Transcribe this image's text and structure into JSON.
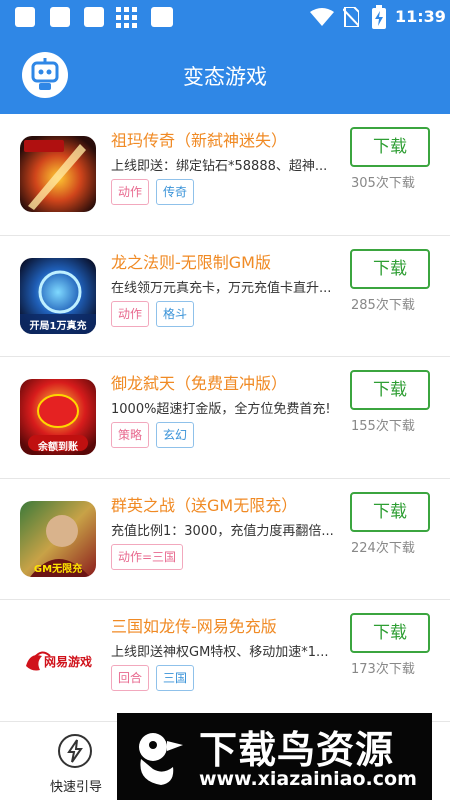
{
  "status_bar": {
    "time": "11:39",
    "icons": [
      "app-square-icon",
      "app-square-icon",
      "app-square-icon",
      "grid-icon",
      "app-square-icon",
      "wifi-icon",
      "no-sim-icon",
      "battery-charging-icon"
    ]
  },
  "header": {
    "title": "变态游戏",
    "avatar_icon": "robot-avatar-icon"
  },
  "games": [
    {
      "name": "祖玛传奇（新弑神迷失）",
      "desc": "上线即送：绑定钻石*58888、超神...",
      "tags": [
        "动作",
        "传奇"
      ],
      "download_label": "下载",
      "downloads": "305次下载",
      "icon_caption": ""
    },
    {
      "name": "龙之法则-无限制GM版",
      "desc": "在线领万元真充卡，万元充值卡直升...",
      "tags": [
        "动作",
        "格斗"
      ],
      "download_label": "下载",
      "downloads": "285次下载",
      "icon_caption": "开局1万真充"
    },
    {
      "name": "御龙弑天（免费直冲版）",
      "desc": "1000%超速打金版，全方位免费首充!",
      "tags": [
        "策略",
        "玄幻"
      ],
      "download_label": "下载",
      "downloads": "155次下载",
      "icon_caption": "余额到账"
    },
    {
      "name": "群英之战（送GM无限充）",
      "desc": "充值比例1：3000，充值力度再翻倍...",
      "tags": [
        "动作=三国"
      ],
      "download_label": "下载",
      "downloads": "224次下载",
      "icon_caption": "GM无限充"
    },
    {
      "name": "三国如龙传-网易免充版",
      "desc": "上线即送神权GM特权、移动加速*1...",
      "tags": [
        "回合",
        "三国"
      ],
      "download_label": "下载",
      "downloads": "173次下载",
      "icon_caption": "网易游戏"
    }
  ],
  "bottom_nav": {
    "guide_label": "快速引导",
    "guide_icon": "lightning-bulb-icon"
  },
  "watermark": {
    "title": "下载鸟资源",
    "url": "www.xiazainiao.com"
  },
  "colors": {
    "header_bg": "#2f87e6",
    "game_name": "#f08a24",
    "download_green": "#2e9e33",
    "tag_pink": "#e86a8f",
    "tag_blue": "#3a93d8"
  }
}
